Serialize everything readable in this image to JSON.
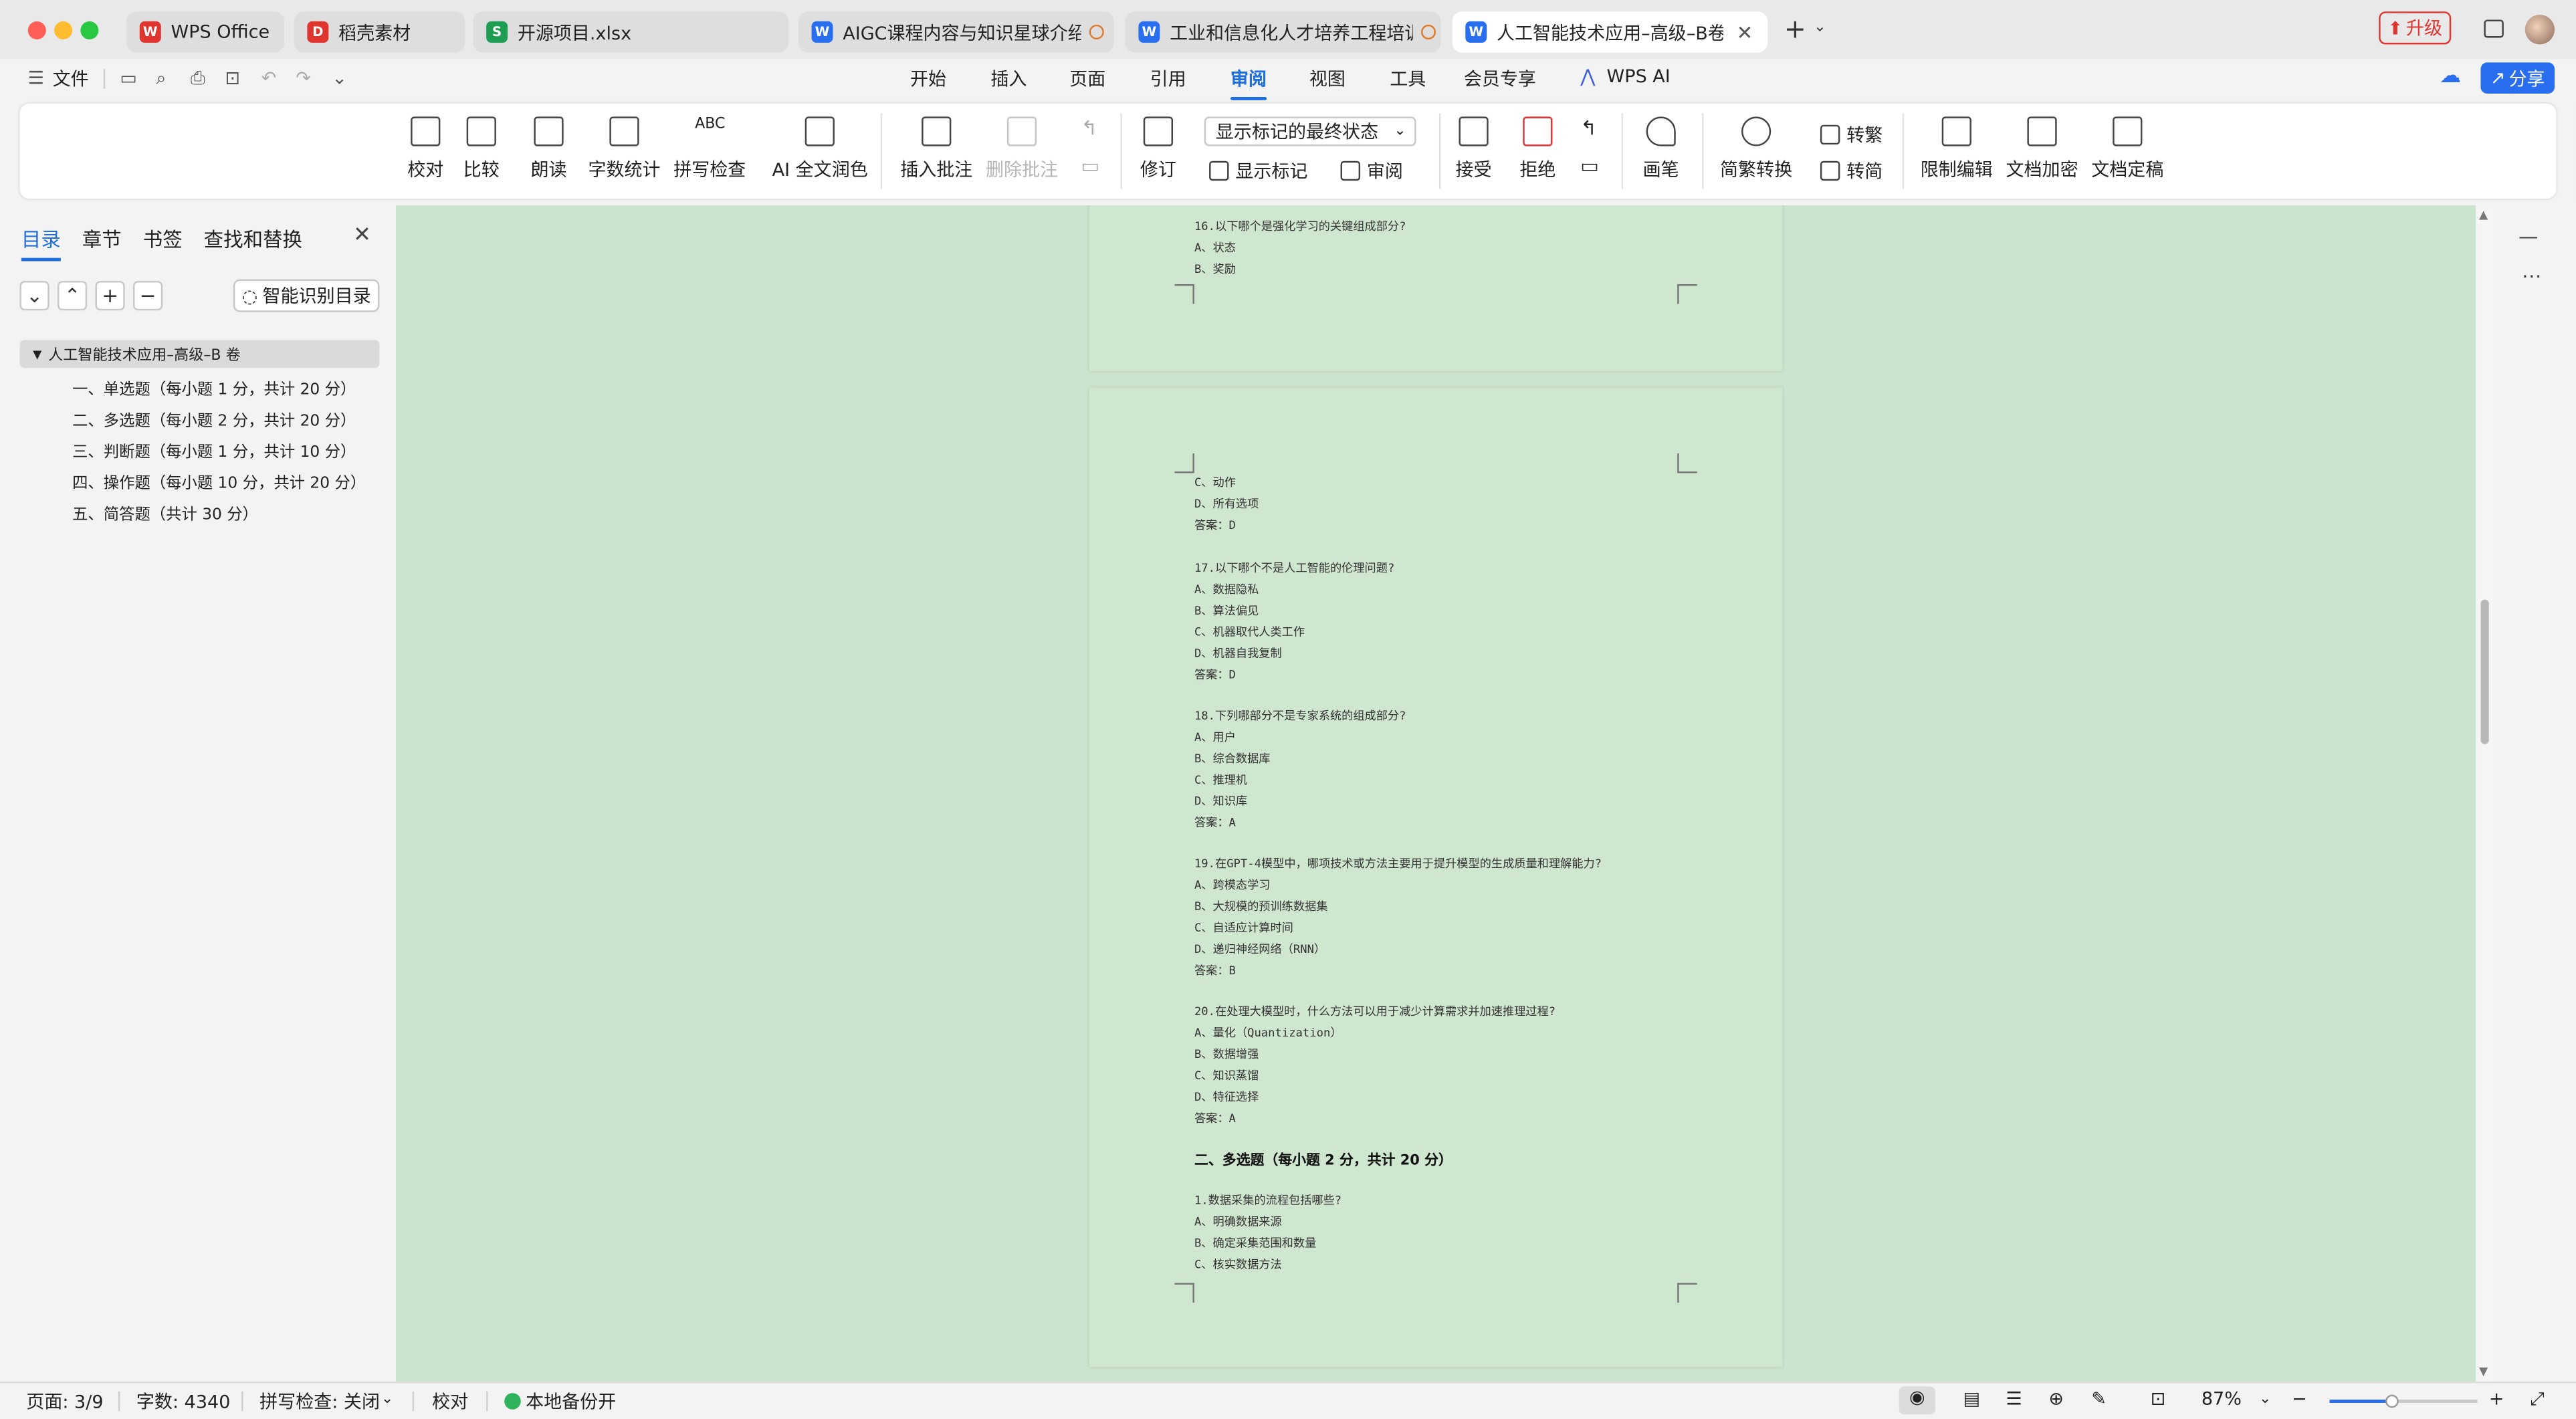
{
  "titlebar": {
    "tabs": [
      {
        "label": "WPS Office",
        "icon": "wps-logo-icon",
        "color": "#e0342f"
      },
      {
        "label": "稻壳素材",
        "icon": "docer-icon",
        "color": "#e0342f"
      },
      {
        "label": "开源项目.xlsx",
        "icon": "spreadsheet-icon",
        "color": "#1e9e53"
      },
      {
        "label": "AIGC课程内容与知识星球介绍.d",
        "icon": "word-doc-icon",
        "color": "#2a6ef0"
      },
      {
        "label": "工业和信息化人才培养工程培训",
        "icon": "word-doc-icon",
        "color": "#2a6ef0"
      },
      {
        "label": "人工智能技术应用–高级–B卷",
        "icon": "word-doc-icon",
        "color": "#2a6ef0"
      }
    ],
    "upgrade_label": "升级"
  },
  "menubar": {
    "file_label": "文件",
    "items": [
      "开始",
      "插入",
      "页面",
      "引用",
      "审阅",
      "视图",
      "工具",
      "会员专享",
      "WPS AI"
    ],
    "active": "审阅",
    "share_label": "分享"
  },
  "ribbon": {
    "proofread": "校对",
    "compare": "比较",
    "read_aloud": "朗读",
    "word_count": "字数统计",
    "spell_check": "拼写检查",
    "ai_polish": "AI 全文润色",
    "insert_comment": "插入批注",
    "delete_comment": "删除批注",
    "track_changes": "修订",
    "markup_select": "显示标记的最终状态",
    "show_markup": "显示标记",
    "review": "审阅",
    "accept": "接受",
    "reject": "拒绝",
    "pen": "画笔",
    "trad_simp": "简繁转换",
    "to_trad": "转繁",
    "to_simp": "转简",
    "restrict_edit": "限制编辑",
    "encrypt": "文档加密",
    "finalize": "文档定稿"
  },
  "leftpanel": {
    "tabs": [
      "目录",
      "章节",
      "书签",
      "查找和替换"
    ],
    "smart_toc": "智能识别目录",
    "toc_root": "人工智能技术应用–高级–B 卷",
    "toc_items": [
      "一、单选题（每小题 1 分，共计 20 分）",
      "二、多选题（每小题 2 分，共计 20 分）",
      "三、判断题（每小题 1 分，共计 10 分）",
      "四、操作题（每小题 10 分，共计 20 分）",
      "五、简答题（共计 30 分）"
    ]
  },
  "document": {
    "page1_lines": [
      "16.以下哪个是强化学习的关键组成部分?",
      "A、状态",
      "B、奖励"
    ],
    "page2_lines": [
      "C、动作",
      "D、所有选项",
      "答案：D",
      "",
      "17.以下哪个不是人工智能的伦理问题?",
      "A、数据隐私",
      "B、算法偏见",
      "C、机器取代人类工作",
      "D、机器自我复制",
      "答案：D",
      "",
      "18.下列哪部分不是专家系统的组成部分?",
      "A、用户",
      "B、综合数据库",
      "C、推理机",
      "D、知识库",
      "答案：A",
      "",
      "19.在GPT-4模型中，哪项技术或方法主要用于提升模型的生成质量和理解能力?",
      "A、跨模态学习",
      "B、大规模的预训练数据集",
      "C、自适应计算时间",
      "D、递归神经网络（RNN）",
      "答案：B",
      "",
      "20.在处理大模型时，什么方法可以用于减少计算需求并加速推理过程?",
      "A、量化（Quantization）",
      "B、数据增强",
      "C、知识蒸馏",
      "D、特征选择",
      "答案：A"
    ],
    "section_heading": "二、多选题（每小题 2 分，共计 20 分）",
    "page2_tail": [
      "1.数据采集的流程包括哪些?",
      "A、明确数据来源",
      "B、确定采集范围和数量",
      "C、核实数据方法"
    ]
  },
  "statusbar": {
    "page": "页面: 3/9",
    "words": "字数: 4340",
    "spell": "拼写检查: 关闭",
    "proof": "校对",
    "backup": "本地备份开",
    "zoom": "87%"
  },
  "colors": {
    "accent": "#1f6fe0",
    "doc_bg": "#cce3cd",
    "page_bg": "#d0e7cf"
  }
}
